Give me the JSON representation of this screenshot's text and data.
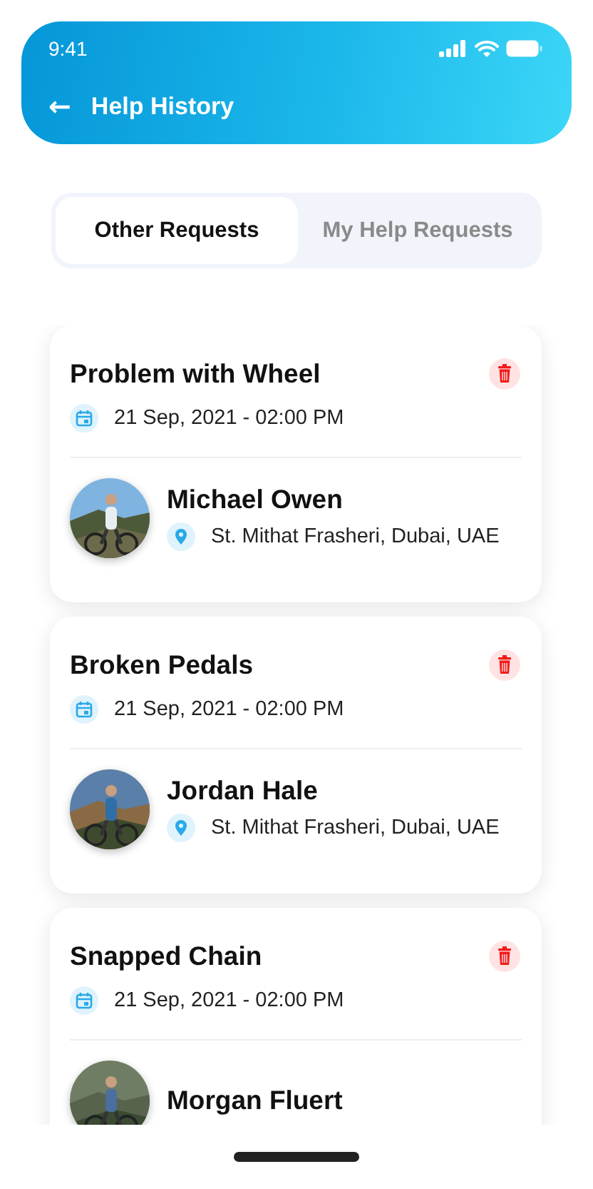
{
  "status_bar": {
    "time": "9:41"
  },
  "header": {
    "back": "←",
    "title": "Help History"
  },
  "tabs": [
    {
      "label": "Other Requests",
      "selected": true
    },
    {
      "label": "My Help Requests",
      "selected": false
    }
  ],
  "requests": [
    {
      "title": "Problem with Wheel",
      "date": "21 Sep, 2021 - 02:00 PM",
      "name": "Michael Owen",
      "location": "St. Mithat Frasheri, Dubai, UAE"
    },
    {
      "title": "Broken Pedals",
      "date": "21 Sep, 2021 - 02:00 PM",
      "name": "Jordan Hale",
      "location": "St. Mithat Frasheri, Dubai, UAE"
    },
    {
      "title": "Snapped Chain",
      "date": "21 Sep, 2021 - 02:00 PM",
      "name": "Morgan Fluert"
    }
  ]
}
